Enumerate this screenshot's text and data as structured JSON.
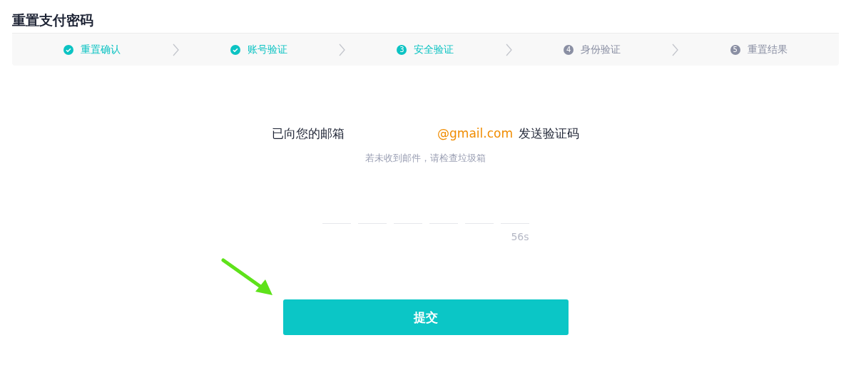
{
  "page_title": "重置支付密码",
  "steps": [
    {
      "label": "重置确认",
      "completed": true,
      "selected": false
    },
    {
      "label": "账号验证",
      "completed": true,
      "selected": false
    },
    {
      "number": "3",
      "label": "安全验证",
      "completed": false,
      "selected": true
    },
    {
      "number": "4",
      "label": "身份验证",
      "completed": false,
      "selected": false
    },
    {
      "number": "5",
      "label": "重置结果",
      "completed": false,
      "selected": false
    }
  ],
  "message": {
    "before": "已向您的邮箱",
    "email": "@gmail.com",
    "after": "发送验证码"
  },
  "hint": "若未收到邮件，请检查垃圾箱",
  "countdown": "56s",
  "submit_button": "提交"
}
